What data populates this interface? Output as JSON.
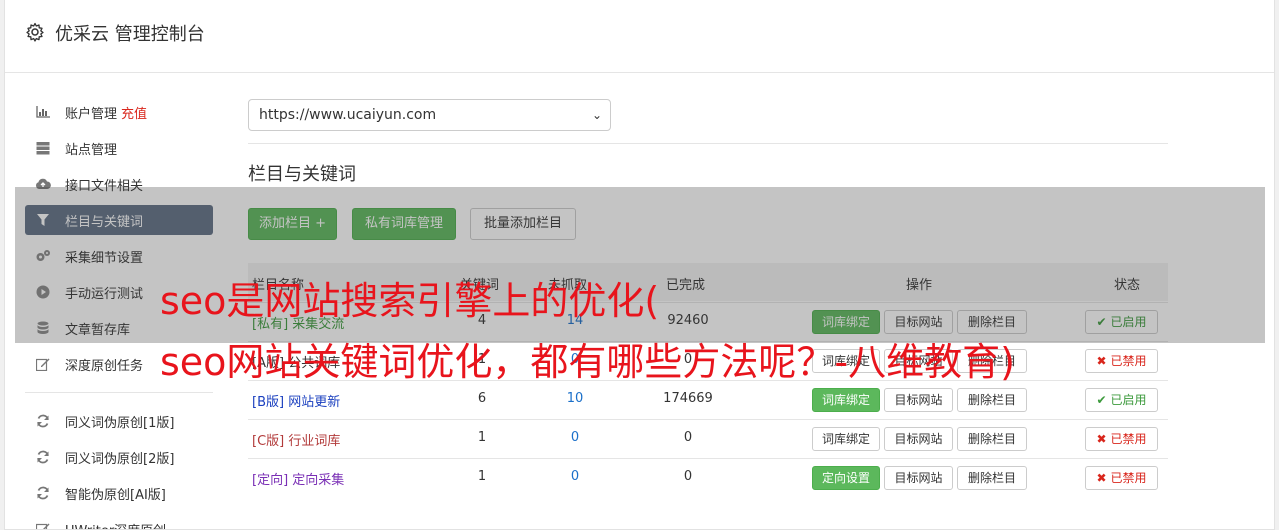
{
  "header": {
    "title": "优采云 管理控制台",
    "icon": "gear-icon"
  },
  "sidebar": {
    "items": [
      {
        "label": "账户管理",
        "extra": "充值",
        "icon": "bar-chart-icon",
        "active": false
      },
      {
        "label": "站点管理",
        "icon": "server-icon",
        "active": false
      },
      {
        "label": "接口文件相关",
        "icon": "cloud-upload-icon",
        "active": false
      },
      {
        "label": "栏目与关键词",
        "icon": "filter-icon",
        "active": true
      },
      {
        "label": "采集细节设置",
        "icon": "gears-icon",
        "active": false
      },
      {
        "label": "手动运行测试",
        "icon": "play-icon",
        "active": false
      },
      {
        "label": "文章暂存库",
        "icon": "database-icon",
        "active": false
      },
      {
        "label": "深度原创任务",
        "icon": "edit-icon",
        "active": false
      }
    ],
    "items2": [
      {
        "label": "同义词伪原创[1版]",
        "icon": "refresh-icon"
      },
      {
        "label": "同义词伪原创[2版]",
        "icon": "refresh-icon"
      },
      {
        "label": "智能伪原创[AI版]",
        "icon": "refresh-icon"
      },
      {
        "label": "UWriter深度原创",
        "icon": "edit-icon"
      }
    ]
  },
  "site_select": {
    "value": "https://www.ucaiyun.com"
  },
  "section_title": "栏目与关键词",
  "toolbar": {
    "add_column": "添加栏目 +",
    "private_lib": "私有词库管理",
    "batch_add": "批量添加栏目"
  },
  "table": {
    "headers": [
      "栏目名称",
      "关键词",
      "未抓取",
      "已完成",
      "操作",
      "状态"
    ],
    "rows": [
      {
        "tag": "[私有]",
        "name": "采集交流",
        "color": "#3c9a3c",
        "n1": "4",
        "n2": "14",
        "n3": "92460",
        "action1": "词库绑定",
        "action1_green": true,
        "action2": "目标网站",
        "action3": "删除栏目",
        "status": "已启用",
        "enabled": true
      },
      {
        "tag": "[A版]",
        "name": "公共词库",
        "color": "#333333",
        "n1": "1",
        "n2": "0",
        "n3": "0",
        "action1": "词库绑定",
        "action1_green": false,
        "action2": "目标网站",
        "action3": "删除栏目",
        "status": "已禁用",
        "enabled": false
      },
      {
        "tag": "[B版]",
        "name": "网站更新",
        "color": "#1a3fbf",
        "n1": "6",
        "n2": "10",
        "n3": "174669",
        "action1": "词库绑定",
        "action1_green": true,
        "action2": "目标网站",
        "action3": "删除栏目",
        "status": "已启用",
        "enabled": true
      },
      {
        "tag": "[C版]",
        "name": "行业词库",
        "color": "#b23a3a",
        "n1": "1",
        "n2": "0",
        "n3": "0",
        "action1": "词库绑定",
        "action1_green": false,
        "action2": "目标网站",
        "action3": "删除栏目",
        "status": "已禁用",
        "enabled": false
      },
      {
        "tag": "[定向]",
        "name": "定向采集",
        "color": "#7a2fb5",
        "n1": "1",
        "n2": "0",
        "n3": "0",
        "action1": "定向设置",
        "action1_green": true,
        "action2": "目标网站",
        "action3": "删除栏目",
        "status": "已禁用",
        "enabled": false
      }
    ]
  },
  "overlay": {
    "line1": "seo是网站搜索引擎上的优化(",
    "line2": "seo网站关键词优化，都有哪些方法呢？-八维教育)"
  }
}
